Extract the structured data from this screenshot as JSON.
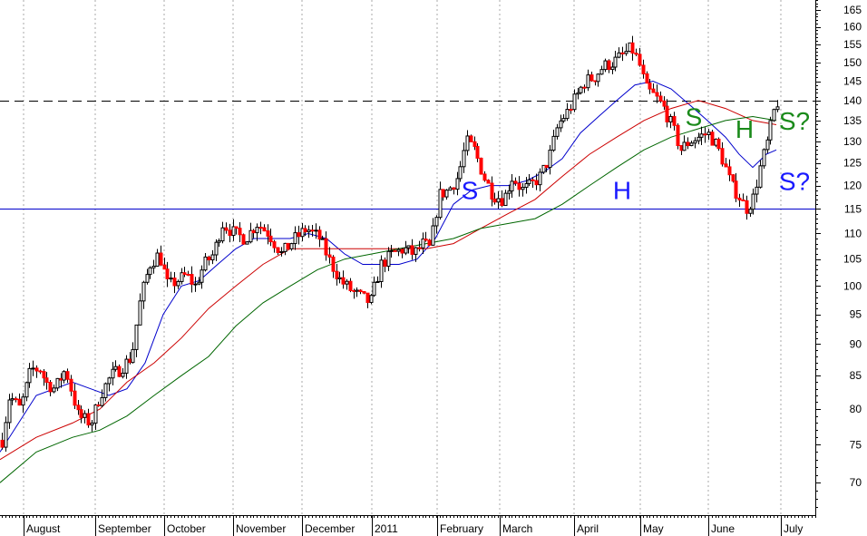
{
  "chart_data": {
    "type": "candlestick",
    "x_labels": [
      "August",
      "September",
      "October",
      "November",
      "December",
      "2011",
      "February",
      "March",
      "April",
      "May",
      "June",
      "July"
    ],
    "y_ticks": [
      70,
      75,
      80,
      85,
      90,
      95,
      100,
      105,
      110,
      115,
      120,
      125,
      130,
      135,
      140,
      145,
      150,
      155,
      160,
      165
    ],
    "ylim": [
      66,
      168
    ],
    "y_scale": "log",
    "grid": "vertical dotted at month starts",
    "up_color": "#ffffff",
    "down_color": "#ff0000",
    "candle_outline": "#000000",
    "anchors": [
      [
        0,
        74
      ],
      [
        10,
        82
      ],
      [
        22,
        80
      ],
      [
        34,
        86
      ],
      [
        44,
        86
      ],
      [
        50,
        84
      ],
      [
        60,
        83
      ],
      [
        72,
        86
      ],
      [
        86,
        79
      ],
      [
        100,
        78
      ],
      [
        110,
        82
      ],
      [
        122,
        85
      ],
      [
        132,
        86
      ],
      [
        145,
        88
      ],
      [
        155,
        98
      ],
      [
        165,
        104
      ],
      [
        175,
        106
      ],
      [
        185,
        100
      ],
      [
        195,
        101
      ],
      [
        205,
        102
      ],
      [
        215,
        100
      ],
      [
        225,
        104
      ],
      [
        235,
        106
      ],
      [
        245,
        112
      ],
      [
        258,
        110
      ],
      [
        270,
        109
      ],
      [
        283,
        112
      ],
      [
        296,
        110
      ],
      [
        310,
        106
      ],
      [
        325,
        109
      ],
      [
        338,
        111
      ],
      [
        352,
        109
      ],
      [
        365,
        104
      ],
      [
        375,
        101
      ],
      [
        388,
        99
      ],
      [
        398,
        98
      ],
      [
        408,
        97
      ],
      [
        420,
        104
      ],
      [
        432,
        106
      ],
      [
        445,
        107
      ],
      [
        456,
        106
      ],
      [
        466,
        108
      ],
      [
        474,
        107
      ],
      [
        484,
        118
      ],
      [
        494,
        119
      ],
      [
        505,
        122
      ],
      [
        514,
        130
      ],
      [
        523,
        128
      ],
      [
        533,
        122
      ],
      [
        543,
        118
      ],
      [
        555,
        117
      ],
      [
        565,
        122
      ],
      [
        575,
        119
      ],
      [
        585,
        120
      ],
      [
        595,
        122
      ],
      [
        605,
        126
      ],
      [
        615,
        134
      ],
      [
        625,
        137
      ],
      [
        635,
        141
      ],
      [
        645,
        145
      ],
      [
        655,
        146
      ],
      [
        665,
        149
      ],
      [
        676,
        150
      ],
      [
        686,
        152
      ],
      [
        696,
        154
      ],
      [
        704,
        150
      ],
      [
        712,
        143
      ],
      [
        722,
        141
      ],
      [
        732,
        138
      ],
      [
        742,
        133
      ],
      [
        750,
        128
      ],
      [
        760,
        130
      ],
      [
        770,
        131
      ],
      [
        780,
        132
      ],
      [
        790,
        129
      ],
      [
        798,
        125
      ],
      [
        806,
        120
      ],
      [
        814,
        118
      ],
      [
        822,
        115
      ],
      [
        830,
        117
      ],
      [
        838,
        124
      ],
      [
        846,
        130
      ],
      [
        854,
        138
      ],
      [
        858,
        140
      ]
    ],
    "moving_averages": [
      {
        "color": "#0000cc",
        "values": [
          [
            0,
            74
          ],
          [
            40,
            82
          ],
          [
            80,
            84
          ],
          [
            100,
            83
          ],
          [
            120,
            82
          ],
          [
            140,
            83
          ],
          [
            160,
            87
          ],
          [
            180,
            95
          ],
          [
            200,
            100
          ],
          [
            220,
            101
          ],
          [
            240,
            104
          ],
          [
            260,
            107
          ],
          [
            280,
            109
          ],
          [
            300,
            109
          ],
          [
            320,
            109
          ],
          [
            340,
            110
          ],
          [
            360,
            109
          ],
          [
            380,
            106
          ],
          [
            400,
            104
          ],
          [
            420,
            104
          ],
          [
            440,
            104
          ],
          [
            460,
            105
          ],
          [
            480,
            109
          ],
          [
            500,
            116
          ],
          [
            520,
            119
          ],
          [
            540,
            120
          ],
          [
            560,
            120
          ],
          [
            580,
            121
          ],
          [
            600,
            123
          ],
          [
            620,
            126
          ],
          [
            640,
            132
          ],
          [
            660,
            136
          ],
          [
            680,
            140
          ],
          [
            700,
            144
          ],
          [
            720,
            145
          ],
          [
            740,
            143
          ],
          [
            760,
            139
          ],
          [
            780,
            135
          ],
          [
            800,
            131
          ],
          [
            815,
            127
          ],
          [
            830,
            124
          ],
          [
            845,
            127
          ],
          [
            856,
            128
          ]
        ]
      },
      {
        "color": "#cc0000",
        "values": [
          [
            0,
            73
          ],
          [
            40,
            76
          ],
          [
            80,
            78
          ],
          [
            110,
            80
          ],
          [
            140,
            84
          ],
          [
            170,
            87
          ],
          [
            200,
            91
          ],
          [
            230,
            96
          ],
          [
            260,
            100
          ],
          [
            290,
            104
          ],
          [
            320,
            107
          ],
          [
            350,
            107
          ],
          [
            380,
            107
          ],
          [
            410,
            107
          ],
          [
            440,
            107
          ],
          [
            470,
            107
          ],
          [
            500,
            108
          ],
          [
            530,
            111
          ],
          [
            560,
            114
          ],
          [
            590,
            117
          ],
          [
            620,
            122
          ],
          [
            650,
            127
          ],
          [
            680,
            131
          ],
          [
            710,
            135
          ],
          [
            740,
            138
          ],
          [
            770,
            140
          ],
          [
            800,
            138
          ],
          [
            830,
            135
          ],
          [
            856,
            134
          ]
        ]
      },
      {
        "color": "#006600",
        "values": [
          [
            0,
            70
          ],
          [
            40,
            74
          ],
          [
            80,
            76
          ],
          [
            110,
            77
          ],
          [
            140,
            79
          ],
          [
            170,
            82
          ],
          [
            200,
            85
          ],
          [
            230,
            88
          ],
          [
            260,
            93
          ],
          [
            290,
            97
          ],
          [
            320,
            100
          ],
          [
            350,
            103
          ],
          [
            380,
            105
          ],
          [
            410,
            106
          ],
          [
            440,
            107
          ],
          [
            470,
            108
          ],
          [
            500,
            109
          ],
          [
            530,
            111
          ],
          [
            560,
            112
          ],
          [
            590,
            113
          ],
          [
            620,
            116
          ],
          [
            650,
            120
          ],
          [
            680,
            124
          ],
          [
            710,
            128
          ],
          [
            740,
            131
          ],
          [
            770,
            133
          ],
          [
            800,
            135
          ],
          [
            830,
            136
          ],
          [
            856,
            135
          ]
        ]
      }
    ],
    "horizontal_lines": [
      {
        "value": 140,
        "style": "dashed",
        "color": "#000000"
      },
      {
        "value": 115,
        "style": "solid",
        "color": "#0000cc"
      }
    ],
    "annotations": [
      {
        "text": "S",
        "x": 518,
        "y": 119,
        "color": "#1a1aff"
      },
      {
        "text": "H",
        "x": 686,
        "y": 119,
        "color": "#1a1aff"
      },
      {
        "text": "S?",
        "x": 876,
        "y": 121,
        "color": "#1a1aff"
      },
      {
        "text": "S",
        "x": 765,
        "y": 136,
        "color": "#1a8a1a"
      },
      {
        "text": "H",
        "x": 821,
        "y": 133,
        "color": "#1a8a1a"
      },
      {
        "text": "S?",
        "x": 876,
        "y": 135,
        "color": "#1a8a1a"
      }
    ]
  }
}
